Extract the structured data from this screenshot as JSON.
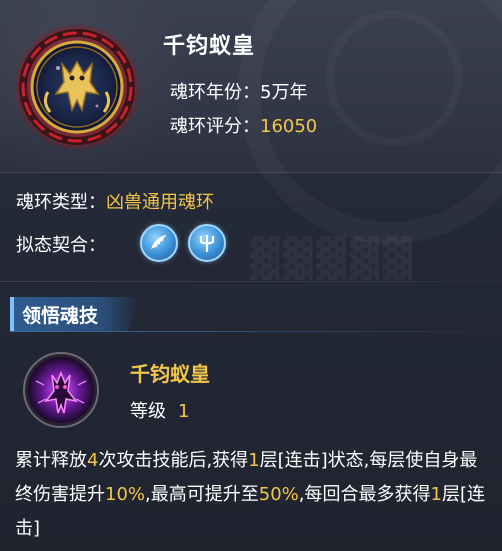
{
  "header": {
    "title": "千钧蚁皇",
    "ring_icon": "golden-ant-emperor-ring-icon",
    "year_label": "魂环年份：",
    "year_value": "5万年",
    "score_label": "魂环评分：",
    "score_value": "16050"
  },
  "details": {
    "type_label": "魂环类型：",
    "type_value": "凶兽通用魂环",
    "affinity_label": "拟态契合：",
    "affinity_icons": [
      "wing-affinity-icon",
      "trident-affinity-icon"
    ]
  },
  "section": {
    "tab_label": "领悟魂技"
  },
  "skill": {
    "icon": "purple-ant-skill-icon",
    "name": "千钧蚁皇",
    "level_label": "等级",
    "level_value": "1",
    "description": {
      "p1": "累计释放",
      "n1": "4",
      "p2": "次攻击技能后,获得",
      "n2": "1",
      "p3": "层[连击]状态,每层使自身最终伤害提升",
      "n3": "10%",
      "p4": ",最高可提升至",
      "n4": "50%",
      "p5": ",每回合最多获得",
      "n5": "1",
      "p6": "层[连击]"
    }
  },
  "colors": {
    "accent_gold": "#f2c64a",
    "section_blue": "#2f5c8f",
    "background": "#242937"
  }
}
